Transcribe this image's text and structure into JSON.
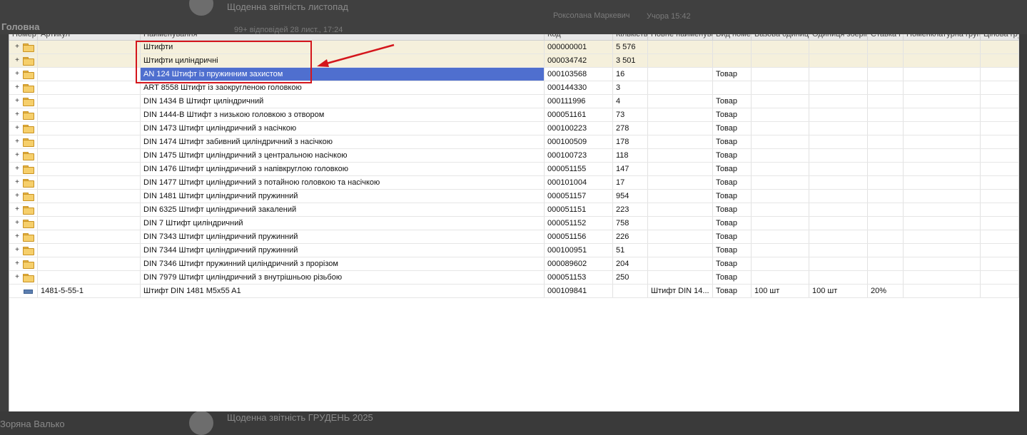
{
  "background": {
    "section_title": "Головна",
    "chat_top_title": "Щоденна звітність листопад",
    "chat_top_meta": "99+ відповідей  28 лист., 17:24",
    "chat_top_author": "Роксолана Маркевич",
    "chat_top_time": "Учора 15:42",
    "chat_bottom_title": "Щоденна звітність ГРУДЕНЬ 2025",
    "bottom_user": "Зоряна Валько"
  },
  "grid": {
    "columns": [
      "Номер",
      "Артикул",
      "Найменування",
      "Код",
      "Кількість",
      "Повне найменування",
      "Вид номенклатури",
      "Базова одиниця",
      "Одиниця зберігання",
      "Ставка ПДВ",
      "Номенклатурна група",
      "Цінова група"
    ],
    "rows": [
      {
        "type": "group",
        "expander": "+",
        "article": "",
        "name": "Штифти",
        "code": "000000001",
        "qty": "5 576",
        "full_name": "",
        "kind": "",
        "base_unit": "",
        "storage_unit": "",
        "vat": ""
      },
      {
        "type": "group",
        "expander": "+",
        "article": "",
        "name": "Штифти циліндричні",
        "code": "000034742",
        "qty": "3 501",
        "full_name": "",
        "kind": "",
        "base_unit": "",
        "storage_unit": "",
        "vat": ""
      },
      {
        "type": "folder",
        "expander": "+",
        "article": "",
        "name": "AN 124 Штифт із пружинним захистом",
        "code": "000103568",
        "qty": "16",
        "full_name": "",
        "kind": "Товар",
        "base_unit": "",
        "storage_unit": "",
        "vat": "",
        "selected": true
      },
      {
        "type": "folder",
        "expander": "+",
        "article": "",
        "name": "ART 8558 Штифт із заокругленою головкою",
        "code": "000144330",
        "qty": "3",
        "full_name": "",
        "kind": "",
        "base_unit": "",
        "storage_unit": "",
        "vat": ""
      },
      {
        "type": "folder",
        "expander": "+",
        "article": "",
        "name": "DIN 1434 B Штифт циліндричний",
        "code": "000111996",
        "qty": "4",
        "full_name": "",
        "kind": "Товар",
        "base_unit": "",
        "storage_unit": "",
        "vat": ""
      },
      {
        "type": "folder",
        "expander": "+",
        "article": "",
        "name": "DIN 1444-B Штифт з низькою головкою з отвором",
        "code": "000051161",
        "qty": "73",
        "full_name": "",
        "kind": "Товар",
        "base_unit": "",
        "storage_unit": "",
        "vat": ""
      },
      {
        "type": "folder",
        "expander": "+",
        "article": "",
        "name": "DIN 1473 Штифт циліндричний з насічкою",
        "code": "000100223",
        "qty": "278",
        "full_name": "",
        "kind": "Товар",
        "base_unit": "",
        "storage_unit": "",
        "vat": ""
      },
      {
        "type": "folder",
        "expander": "+",
        "article": "",
        "name": "DIN 1474 Штифт забивний циліндричний з насічкою",
        "code": "000100509",
        "qty": "178",
        "full_name": "",
        "kind": "Товар",
        "base_unit": "",
        "storage_unit": "",
        "vat": ""
      },
      {
        "type": "folder",
        "expander": "+",
        "article": "",
        "name": "DIN 1475 Штифт циліндричний з центральною насічкою",
        "code": "000100723",
        "qty": "118",
        "full_name": "",
        "kind": "Товар",
        "base_unit": "",
        "storage_unit": "",
        "vat": ""
      },
      {
        "type": "folder",
        "expander": "+",
        "article": "",
        "name": "DIN 1476 Штифт циліндричний з напівкруглою головкою",
        "code": "000051155",
        "qty": "147",
        "full_name": "",
        "kind": "Товар",
        "base_unit": "",
        "storage_unit": "",
        "vat": ""
      },
      {
        "type": "folder",
        "expander": "+",
        "article": "",
        "name": "DIN 1477 Штифт циліндричний з потайною головкою та насічкою",
        "code": "000101004",
        "qty": "17",
        "full_name": "",
        "kind": "Товар",
        "base_unit": "",
        "storage_unit": "",
        "vat": ""
      },
      {
        "type": "folder",
        "expander": "+",
        "article": "",
        "name": "DIN 1481 Штифт циліндричний пружинний",
        "code": "000051157",
        "qty": "954",
        "full_name": "",
        "kind": "Товар",
        "base_unit": "",
        "storage_unit": "",
        "vat": ""
      },
      {
        "type": "folder",
        "expander": "+",
        "article": "",
        "name": "DIN 6325 Штифт циліндричний закалений",
        "code": "000051151",
        "qty": "223",
        "full_name": "",
        "kind": "Товар",
        "base_unit": "",
        "storage_unit": "",
        "vat": ""
      },
      {
        "type": "folder",
        "expander": "+",
        "article": "",
        "name": "DIN 7 Штифт циліндричний",
        "code": "000051152",
        "qty": "758",
        "full_name": "",
        "kind": "Товар",
        "base_unit": "",
        "storage_unit": "",
        "vat": ""
      },
      {
        "type": "folder",
        "expander": "+",
        "article": "",
        "name": "DIN 7343 Штифт циліндричний пружинний",
        "code": "000051156",
        "qty": "226",
        "full_name": "",
        "kind": "Товар",
        "base_unit": "",
        "storage_unit": "",
        "vat": ""
      },
      {
        "type": "folder",
        "expander": "+",
        "article": "",
        "name": "DIN 7344 Штифт  циліндричний пружинний",
        "code": "000100951",
        "qty": "51",
        "full_name": "",
        "kind": "Товар",
        "base_unit": "",
        "storage_unit": "",
        "vat": ""
      },
      {
        "type": "folder",
        "expander": "+",
        "article": "",
        "name": "DIN 7346 Штифт пружинний циліндричний з прорізом",
        "code": "000089602",
        "qty": "204",
        "full_name": "",
        "kind": "Товар",
        "base_unit": "",
        "storage_unit": "",
        "vat": ""
      },
      {
        "type": "folder",
        "expander": "+",
        "article": "",
        "name": "DIN 7979 Штифт циліндричний з внутрішньою різьбою",
        "code": "000051153",
        "qty": "250",
        "full_name": "",
        "kind": "Товар",
        "base_unit": "",
        "storage_unit": "",
        "vat": ""
      },
      {
        "type": "item",
        "expander": "",
        "article": "1481-5-55-1",
        "name": "Штифт DIN 1481 M5x55 A1",
        "code": "000109841",
        "qty": "",
        "full_name": "Штифт DIN 14...",
        "kind": "Товар",
        "base_unit": "100 шт",
        "storage_unit": "100 шт",
        "vat": "20%"
      }
    ]
  },
  "annotation": {
    "box_color": "#d4161c",
    "arrow_color": "#d4161c"
  },
  "colors": {
    "selection": "#4f6fcf",
    "group_row": "#f5f0dc",
    "folder": "#f6cf6b"
  }
}
